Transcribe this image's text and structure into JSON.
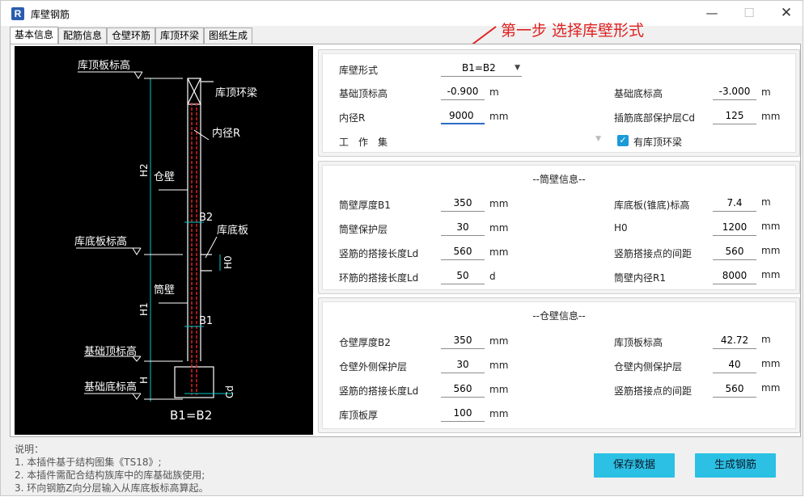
{
  "window": {
    "title": "库壁钢筋",
    "app_icon": "R"
  },
  "annotation": "第一步 选择库壁形式",
  "tabs": [
    "基本信息",
    "配筋信息",
    "仓壁环筋",
    "库顶环梁",
    "图纸生成"
  ],
  "drawing": {
    "labels": {
      "top_elev": "库顶板标高",
      "ring_beam": "库顶环梁",
      "inner_r": "内径R",
      "h2": "H2",
      "silo_wall": "仓壁",
      "b2": "B2",
      "bottom_slab": "库底板",
      "bottom_slab_elev": "库底板标高",
      "h0": "H0",
      "tube_wall": "筒壁",
      "h1": "H1",
      "b1": "B1",
      "found_top": "基础顶标高",
      "found_bottom": "基础底标高",
      "h": "H",
      "cd": "Cd",
      "form": "B1=B2"
    }
  },
  "basic": {
    "wall_form_label": "库壁形式",
    "wall_form_value": "B1=B2",
    "found_top_label": "基础顶标高",
    "found_top_value": "-0.900",
    "found_top_unit": "m",
    "found_bottom_label": "基础底标高",
    "found_bottom_value": "-3.000",
    "found_bottom_unit": "m",
    "inner_r_label": "内径R",
    "inner_r_value": "9000",
    "inner_r_unit": "mm",
    "cd_label": "插筋底部保护层Cd",
    "cd_value": "125",
    "cd_unit": "mm",
    "workset_label": "工　作　集",
    "ring_beam_check_label": "有库顶环梁"
  },
  "tube": {
    "title": "--筒壁信息--",
    "rows": [
      {
        "l": "筒壁厚度B1",
        "v": "350",
        "u": "mm",
        "rl": "库底板(锥底)标高",
        "rv": "7.4",
        "ru": "m"
      },
      {
        "l": "筒壁保护层",
        "v": "30",
        "u": "mm",
        "rl": "H0",
        "rv": "1200",
        "ru": "mm"
      },
      {
        "l": "竖筋的搭接长度Ld",
        "v": "560",
        "u": "mm",
        "rl": "竖筋搭接点的间距",
        "rv": "560",
        "ru": "mm"
      },
      {
        "l": "环筋的搭接长度Ld",
        "v": "50",
        "u": "d",
        "rl": "筒壁内径R1",
        "rv": "8000",
        "ru": "mm"
      }
    ]
  },
  "silo": {
    "title": "--仓壁信息--",
    "rows": [
      {
        "l": "仓壁厚度B2",
        "v": "350",
        "u": "mm",
        "rl": "库顶板标高",
        "rv": "42.72",
        "ru": "m"
      },
      {
        "l": "仓壁外侧保护层",
        "v": "30",
        "u": "mm",
        "rl": "仓壁内侧保护层",
        "rv": "40",
        "ru": "mm"
      },
      {
        "l": "竖筋的搭接长度Ld",
        "v": "560",
        "u": "mm",
        "rl": "竖筋搭接点的间距",
        "rv": "560",
        "ru": "mm"
      },
      {
        "l": "库顶板厚",
        "v": "100",
        "u": "mm",
        "rl": "",
        "rv": "",
        "ru": ""
      }
    ]
  },
  "notes": [
    "说明：",
    "1. 本插件基于结构图集《TS18》;",
    "2. 本插件需配合结构族库中的库基础族使用;",
    "3. 环向钢筋Z向分层输入从库底板标高算起。"
  ],
  "buttons": {
    "save": "保存数据",
    "generate": "生成钢筋"
  },
  "colors": {
    "accent": "#2bc0e4",
    "annotation": "#e02020",
    "drawing_bg": "#000000",
    "rebar": "#e02020",
    "dim": "#00c8c8"
  }
}
